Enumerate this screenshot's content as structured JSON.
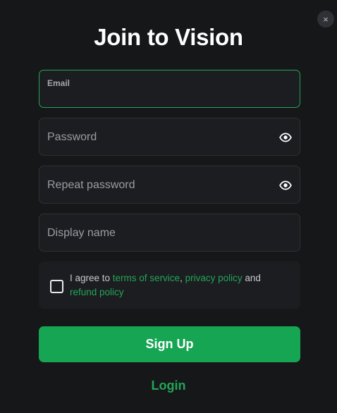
{
  "modal": {
    "title": "Join to Vision",
    "close_label": "×"
  },
  "fields": {
    "email": {
      "label": "Email",
      "value": ""
    },
    "password": {
      "placeholder": "Password",
      "icon": "eye-icon"
    },
    "repeat_password": {
      "placeholder": "Repeat password",
      "icon": "eye-icon"
    },
    "display_name": {
      "placeholder": "Display name"
    }
  },
  "agreement": {
    "prefix": "I agree to ",
    "terms_link": "terms of service",
    "comma": ", ",
    "privacy_link": "privacy policy",
    "and": " and ",
    "refund_link": "refund policy",
    "checked": false
  },
  "actions": {
    "signup_label": "Sign Up",
    "login_label": "Login"
  },
  "colors": {
    "background": "#161719",
    "field_bg": "#1c1d21",
    "accent": "#16a553",
    "link": "#22a557"
  }
}
